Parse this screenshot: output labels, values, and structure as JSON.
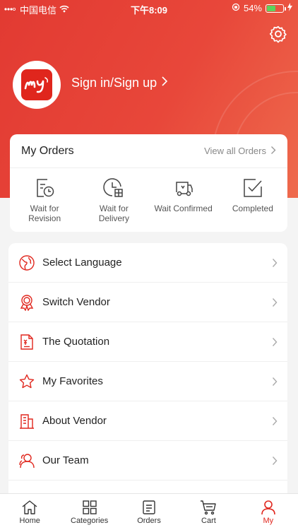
{
  "status_bar": {
    "carrier": "中国电信",
    "time": "下午8:09",
    "battery": "54%",
    "battery_level": 0.54
  },
  "profile": {
    "signin_label": "Sign in/Sign up"
  },
  "orders": {
    "title": "My Orders",
    "view_all": "View all Orders",
    "items": [
      {
        "label_line1": "Wait for",
        "label_line2": "Revision"
      },
      {
        "label_line1": "Wait for",
        "label_line2": "Delivery"
      },
      {
        "label_line1": "Wait Confirmed",
        "label_line2": ""
      },
      {
        "label_line1": "Completed",
        "label_line2": ""
      }
    ]
  },
  "menu": {
    "items": [
      {
        "label": "Select Language"
      },
      {
        "label": "Switch Vendor"
      },
      {
        "label": "The Quotation"
      },
      {
        "label": "My Favorites"
      },
      {
        "label": "About Vendor"
      },
      {
        "label": "Our Team"
      }
    ]
  },
  "tabbar": {
    "tabs": [
      {
        "label": "Home"
      },
      {
        "label": "Categories"
      },
      {
        "label": "Orders"
      },
      {
        "label": "Cart"
      },
      {
        "label": "My"
      }
    ],
    "active": "My"
  },
  "colors": {
    "brand": "#e0261d",
    "header_start": "#e23a32",
    "header_end": "#ee6a4d"
  }
}
